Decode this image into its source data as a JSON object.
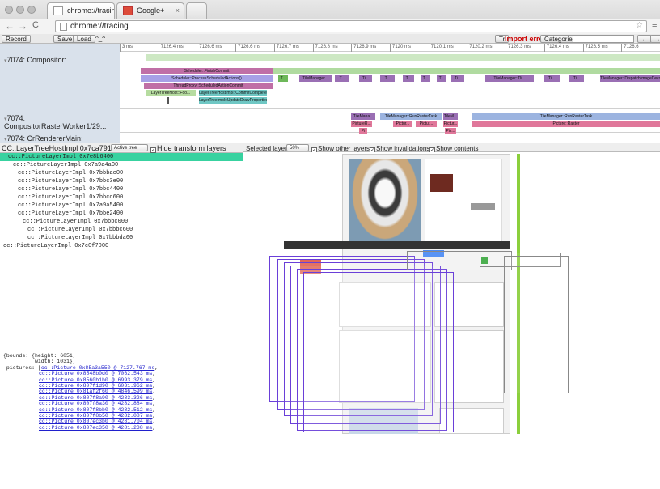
{
  "browser": {
    "tabs": [
      {
        "title": "chrome://tracing",
        "close": "×"
      },
      {
        "title": "Google+",
        "close": "×"
      }
    ],
    "url": "chrome://tracing",
    "back": "←",
    "forward": "→",
    "reload": "C",
    "star": "☆",
    "menu": "≡"
  },
  "toolbar": {
    "record": "Record",
    "save": "Save",
    "load": "Load",
    "caret": "^_^",
    "tt": "Tr",
    "import_errors": "Import errors!",
    "categories": "Categories",
    "nav_left": "←",
    "nav_right": "→"
  },
  "ruler": {
    "ticks": [
      "3 ms",
      "7126.4 ms",
      "7126.6 ms",
      "7126.6 ms",
      "7126.7 ms",
      "7126.8 ms",
      "7126.9 ms",
      "7120 ms",
      "7120.1 ms",
      "7120.2 ms",
      "7126.3 ms",
      "7126.4 ms",
      "7126.5 ms",
      "7126.6"
    ]
  },
  "threads": [
    {
      "label": "7074: Compositor:"
    },
    {
      "label": "7074: CompositorRasterWorker1/29..."
    },
    {
      "label": "7074: CrRendererMain:"
    }
  ],
  "slices": {
    "finish_commit": "Scheduler::FinishCommit",
    "process_actions": "Scheduler::ProcessScheduledActions()",
    "thread_proxy": "ThreadProxy::ScheduledActionCommit",
    "lth_foo": "LayerTreeHost::Foo...",
    "lth_commit": "LayerTreeHostImpl::CommitComplete",
    "lth_update": "LayerTreeImpl::UpdateDrawProperties",
    "tile_manager": "TileManager...",
    "tile_dispatch": "TileManager::DispatchImageDecodeT...",
    "tile_raster": "TileManager::RunRasterTask",
    "picture_raster": "Picture::Raster",
    "tile_short": "TileMana...",
    "tile_short2": "TileM...",
    "picture_short": "PictureR...",
    "picture_short2": "Pictur...",
    "pic": "Pic...",
    "pi": "Pi",
    "t": "T...",
    "ti": "Ti...",
    "tile_d": "TileManager::Di..."
  },
  "left_panel": {
    "title": "CC::LayerTreeHostImpl 0x7ca79190",
    "mode": "Active tree",
    "hide_transform": "Hide transform layers",
    "layers": [
      {
        "name": "cc::PictureLayerImpl 0x7e8b6400",
        "depth": 1,
        "selected": true
      },
      {
        "name": "cc::PictureLayerImpl 0x7a9a4a00",
        "depth": 2
      },
      {
        "name": "cc::PictureLayerImpl 0x7bbbac00",
        "depth": 3
      },
      {
        "name": "cc::PictureLayerImpl 0x7bbc3e00",
        "depth": 3
      },
      {
        "name": "cc::PictureLayerImpl 0x7bbc4400",
        "depth": 3
      },
      {
        "name": "cc::PictureLayerImpl 0x7bbcc600",
        "depth": 3
      },
      {
        "name": "cc::PictureLayerImpl 0x7a9a5400",
        "depth": 3
      },
      {
        "name": "cc::PictureLayerImpl 0x7bbe2400",
        "depth": 3
      },
      {
        "name": "cc::PictureLayerImpl 0x7bbbc000",
        "depth": 4
      },
      {
        "name": "cc::PictureLayerImpl 0x7bbbc600",
        "depth": 5
      },
      {
        "name": "cc::PictureLayerImpl 0x7bbbda00",
        "depth": 5
      },
      {
        "name": "cc::PictureLayerImpl 0x7c0f7000",
        "depth": 0
      }
    ]
  },
  "props": {
    "line1": "{bounds: {height: 6051,",
    "line2": "          width: 1031},",
    "pictures_label": " pictures: [",
    "pictures": [
      "cc::Picture 0x85a3a550 @ 7127.767 ms",
      "cc::Picture 0x8548b0d0 @ 7062.543 ms",
      "cc::Picture 0x8560b1b0 @ 6993.379 ms",
      "cc::Picture 0x807f1d90 @ 6031.962 ms",
      "cc::Picture 0x81af2f60 @ 4846.599 ms",
      "cc::Picture 0x807f8a90 @ 4283.326 ms",
      "cc::Picture 0x807f8a30 @ 4282.884 ms",
      "cc::Picture 0x807f8bb0 @ 4282.512 ms",
      "cc::Picture 0x807f8b50 @ 4282.087 ms",
      "cc::Picture 0x807ec3b0 @ 4281.704 ms",
      "cc::Picture 0x807ec350 @ 4281.238 ms"
    ]
  },
  "right_panel": {
    "selected_layer": "Selected layer",
    "zoom": "50%",
    "show_other": "Show other layers",
    "show_invalidations": "Show invalidations",
    "show_contents": "Show contents"
  },
  "colors": {
    "selected_row": "#38d2a0",
    "track_label_bg": "#d9e1eb",
    "layer_outline": "#6a3fd8",
    "import_errors": "#cc0000"
  }
}
